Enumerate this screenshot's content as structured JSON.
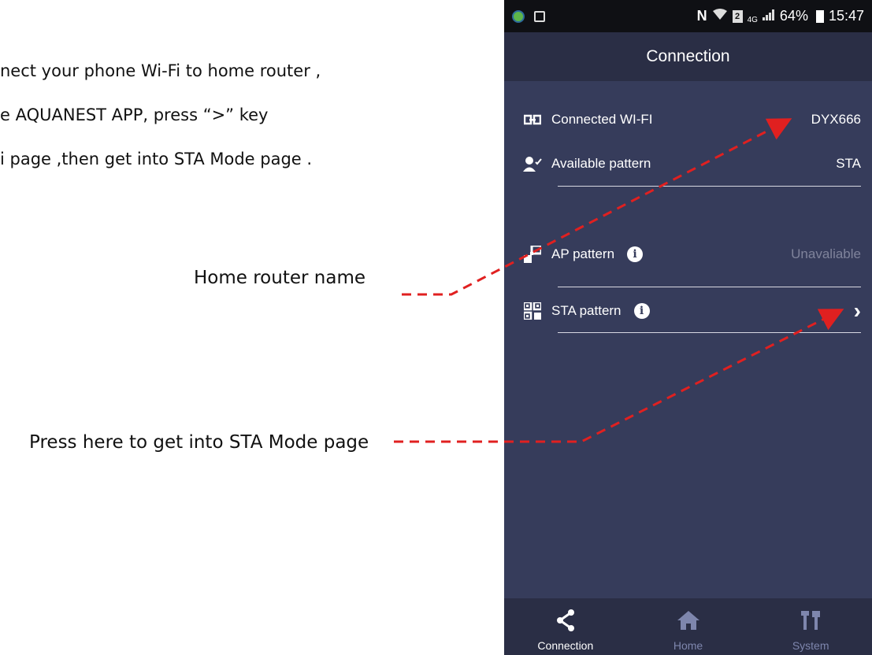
{
  "instructions": {
    "line1": "nect your phone Wi-Fi to home router ,",
    "line2": "e AQUANEST APP,     press “>”     key",
    "line3": "i page ,then get into STA Mode page ."
  },
  "callouts": {
    "router": "Home router name",
    "sta": "Press here to get into STA Mode page"
  },
  "status_bar": {
    "left_icons": [
      "app-notification-icon",
      "gallery-icon"
    ],
    "network": "4G",
    "battery": "64%",
    "time": "15:47"
  },
  "header": {
    "title": "Connection"
  },
  "rows": {
    "connected": {
      "label": "Connected WI-FI",
      "value": "DYX666",
      "icon": "link-icon"
    },
    "available": {
      "label": "Available pattern",
      "value": "STA",
      "icon": "person-check-icon"
    },
    "ap": {
      "label": "AP pattern",
      "value": "Unavaliable",
      "icon": "ap-icon"
    },
    "sta": {
      "label": "STA pattern",
      "value": "›",
      "icon": "qr-icon"
    }
  },
  "nav": {
    "connection": "Connection",
    "home": "Home",
    "system": "System"
  },
  "colors": {
    "screen_bg": "#363c5b",
    "bar_bg": "#2a2e45",
    "status_bg": "#0f1014",
    "callout_red": "#e02020",
    "inactive_nav": "#7e86ad"
  }
}
